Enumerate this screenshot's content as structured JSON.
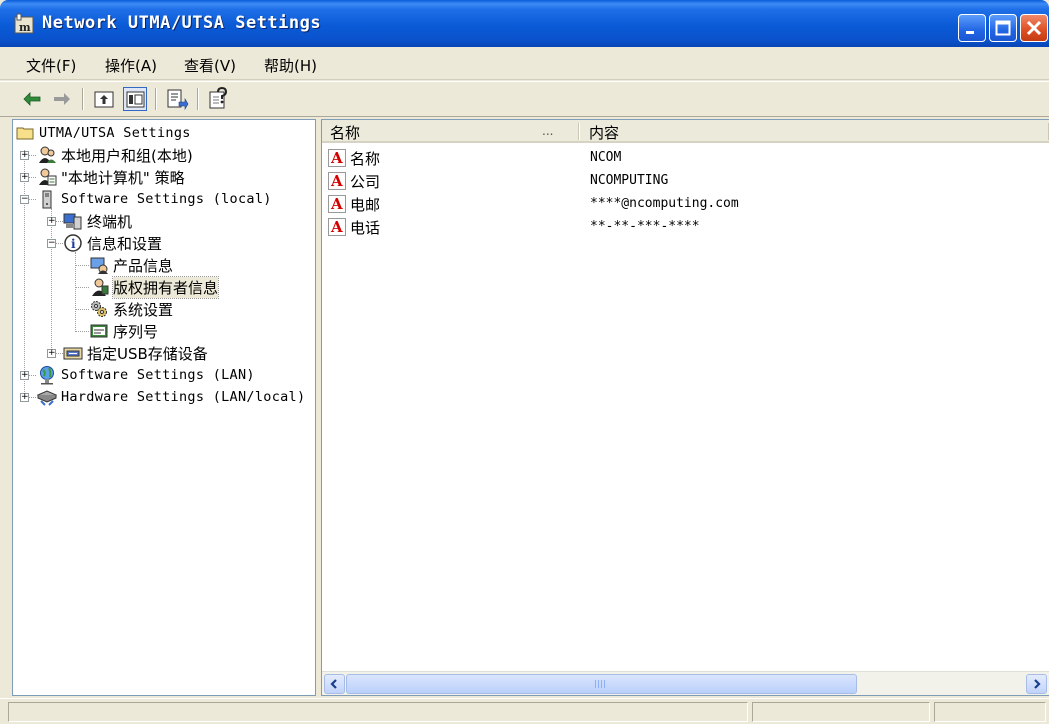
{
  "window": {
    "title": "Network UTMA/UTSA Settings",
    "controls": [
      "minimize-icon",
      "maximize-icon",
      "close-icon"
    ]
  },
  "menu": {
    "file": "文件(F)",
    "action": "操作(A)",
    "view": "查看(V)",
    "help": "帮助(H)"
  },
  "toolbar": {
    "buttons": [
      "back-arrow-icon",
      "forward-arrow-icon",
      "up-folder-icon",
      "show-tree-icon",
      "export-list-icon",
      "help-icon"
    ]
  },
  "tree": {
    "root": "UTMA/UTSA Settings",
    "local_users": "本地用户和组(本地)",
    "local_policy": "\"本地计算机\" 策略",
    "software_local": "Software Settings (local)",
    "terminal": "终端机",
    "info_settings": "信息和设置",
    "product_info": "产品信息",
    "copyright_info": "版权拥有者信息",
    "system_settings": "系统设置",
    "serial_number": "序列号",
    "usb_storage": "指定USB存储设备",
    "software_lan": "Software Settings (LAN)",
    "hardware_lan": "Hardware Settings (LAN/local)"
  },
  "list": {
    "columns": {
      "name": "名称",
      "dots": "...",
      "content": "内容"
    },
    "rows": [
      {
        "name": "名称",
        "value": "NCOM"
      },
      {
        "name": "公司",
        "value": "NCOMPUTING"
      },
      {
        "name": "电邮",
        "value": "****@ncomputing.com"
      },
      {
        "name": "电话",
        "value": "**-**-***-****"
      }
    ]
  },
  "colors": {
    "title_blue": "#0a5ad6",
    "selection_gray": "#ece9d8",
    "string_icon_red": "#d40000"
  }
}
